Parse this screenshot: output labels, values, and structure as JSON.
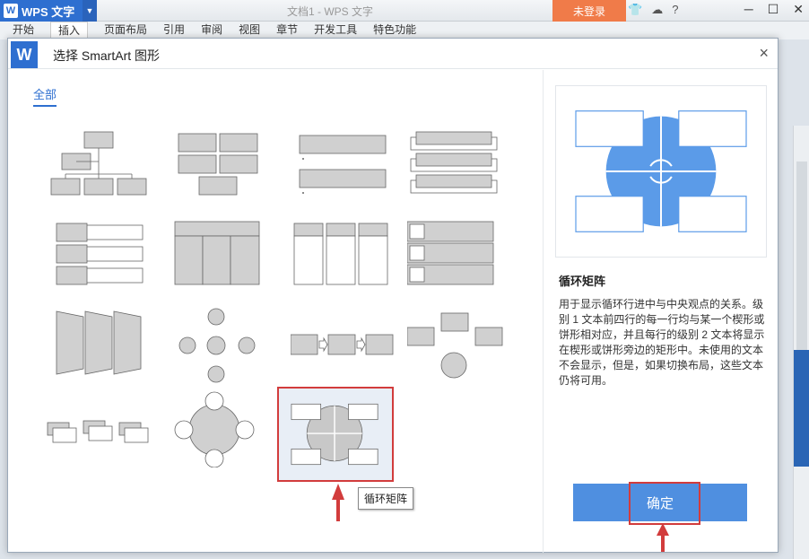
{
  "app": {
    "name": "WPS 文字",
    "logo": "W",
    "doc_title": "文档1 - WPS 文字",
    "login": "未登录"
  },
  "ribbon_tabs": [
    "开始",
    "插入",
    "页面布局",
    "引用",
    "审阅",
    "视图",
    "章节",
    "开发工具",
    "特色功能"
  ],
  "dialog": {
    "title": "选择 SmartArt 图形",
    "logo": "W",
    "close": "×",
    "tab_all": "全部",
    "tooltip": "循环矩阵",
    "preview": {
      "name": "循环矩阵",
      "description": "用于显示循环行进中与中央观点的关系。级别 1 文本前四行的每一行均与某一个楔形或饼形相对应，并且每行的级别 2 文本将显示在楔形或饼形旁边的矩形中。未使用的文本不会显示，但是，如果切换布局，这些文本仍将可用。"
    },
    "ok_button": "确定"
  },
  "colors": {
    "accent": "#2e6fd0",
    "login": "#f07b49",
    "highlight": "#d23c3c",
    "preview_blue": "#5b9be8",
    "ok": "#4f8fe0"
  }
}
